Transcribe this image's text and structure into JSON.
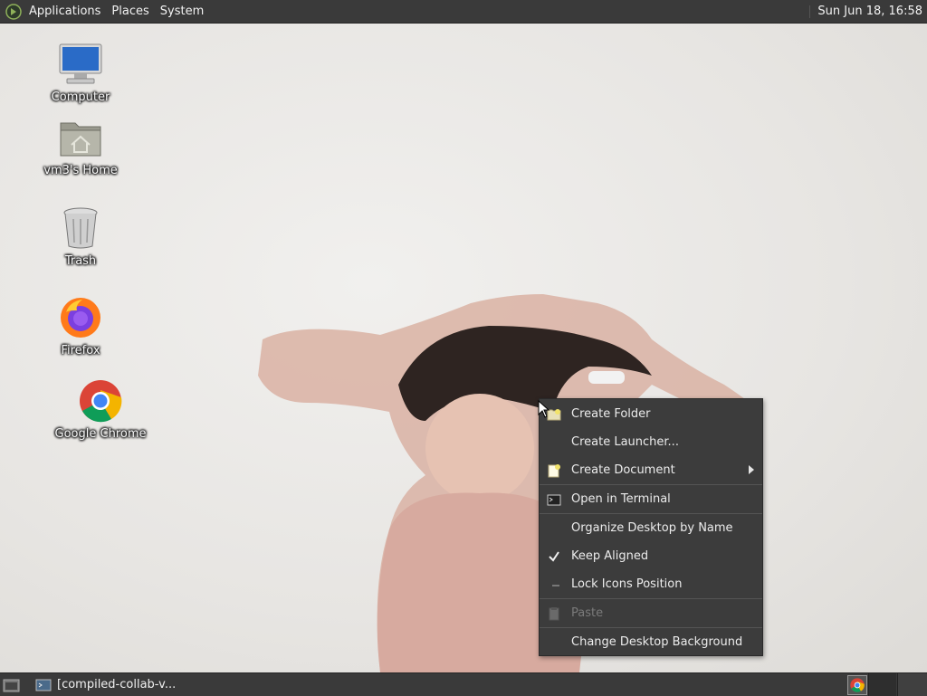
{
  "top_panel": {
    "menus": [
      "Applications",
      "Places",
      "System"
    ],
    "clock": "Sun Jun 18, 16:58"
  },
  "desktop_icons": [
    {
      "label": "Computer",
      "icon": "computer-icon"
    },
    {
      "label": "vm3's Home",
      "icon": "home-folder-icon"
    },
    {
      "label": "Trash",
      "icon": "trash-icon"
    },
    {
      "label": "Firefox",
      "icon": "firefox-icon"
    },
    {
      "label": "Google Chrome",
      "icon": "chrome-icon"
    }
  ],
  "context_menu": {
    "items": [
      {
        "label": "Create Folder",
        "icon": "new-folder-icon"
      },
      {
        "label": "Create Launcher...",
        "icon": ""
      },
      {
        "label": "Create Document",
        "icon": "new-document-icon",
        "submenu": true
      },
      {
        "label": "Open in Terminal",
        "icon": "terminal-icon"
      },
      {
        "label": "Organize Desktop by Name",
        "icon": ""
      },
      {
        "label": "Keep Aligned",
        "icon": "checkmark-icon",
        "checked": true
      },
      {
        "label": "Lock Icons Position",
        "icon": "unchecked-icon",
        "checked": false
      },
      {
        "label": "Paste",
        "icon": "paste-icon",
        "disabled": true
      },
      {
        "label": "Change Desktop Background",
        "icon": ""
      }
    ]
  },
  "bottom_panel": {
    "task_label": "[compiled-collab-v...",
    "colors": {
      "panel": "#3a3a3a",
      "menu_bg": "#3c3c3c"
    }
  }
}
